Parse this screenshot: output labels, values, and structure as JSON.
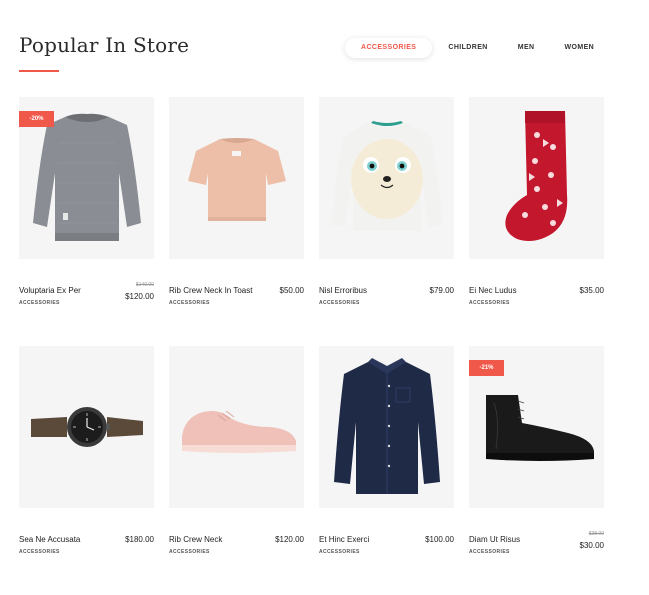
{
  "section": {
    "title": "Popular In Store"
  },
  "tabs": [
    {
      "label": "ACCESSORIES",
      "active": true
    },
    {
      "label": "CHILDREN",
      "active": false
    },
    {
      "label": "MEN",
      "active": false
    },
    {
      "label": "WOMEN",
      "active": false
    }
  ],
  "colors": {
    "accent": "#f0584a",
    "card_bg": "#f5f5f5"
  },
  "products": [
    {
      "name": "Voluptaria Ex Per",
      "category": "ACCESSORIES",
      "price": "$120.00",
      "old_price": "$140.00",
      "badge": "-20%",
      "image": "grey-sweater"
    },
    {
      "name": "Rib Crew Neck In Toast",
      "category": "ACCESSORIES",
      "price": "$50.00",
      "image": "pink-tshirt"
    },
    {
      "name": "Nisl Erroribus",
      "category": "ACCESSORIES",
      "price": "$79.00",
      "image": "sheep-sweater"
    },
    {
      "name": "Ei Nec Ludus",
      "category": "ACCESSORIES",
      "price": "$35.00",
      "image": "red-sock"
    },
    {
      "name": "Sea Ne Accusata",
      "category": "ACCESSORIES",
      "price": "$180.00",
      "image": "wrist-watch"
    },
    {
      "name": "Rib Crew Neck",
      "category": "ACCESSORIES",
      "price": "$120.00",
      "image": "pink-sneaker"
    },
    {
      "name": "Et Hinc Exerci",
      "category": "ACCESSORIES",
      "price": "$100.00",
      "image": "navy-shirt"
    },
    {
      "name": "Diam Ut Risus",
      "category": "ACCESSORIES",
      "price": "$30.00",
      "old_price": "$38.00",
      "badge": "-21%",
      "image": "black-boot"
    }
  ]
}
